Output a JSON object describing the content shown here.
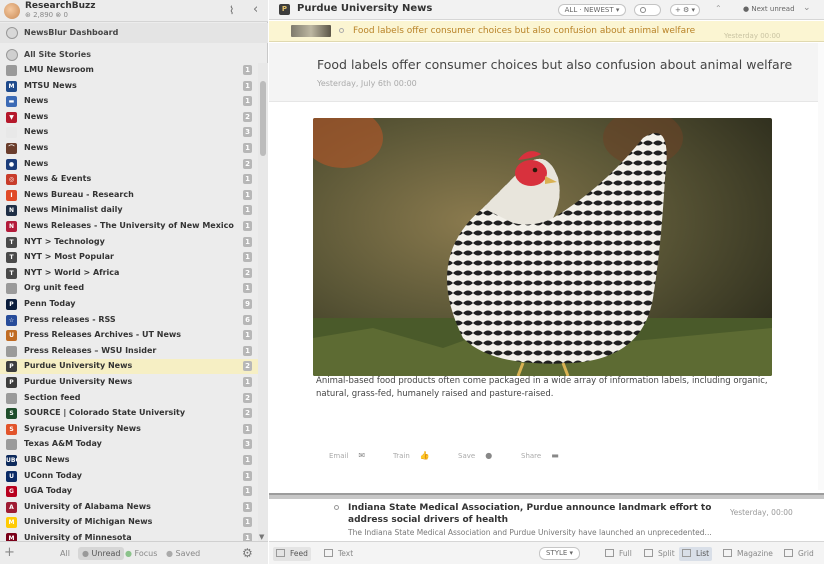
{
  "sidebar": {
    "username": "ResearchBuzz",
    "stats": "⊛ 2,890  ⊗ 0",
    "dashboard_label": "NewsBlur Dashboard",
    "all_stories_label": "All Site Stories",
    "feeds": [
      {
        "name": "LMU Newsroom",
        "count": "1",
        "icon_color": "#9a9a9a",
        "icon_text": ""
      },
      {
        "name": "MTSU News",
        "count": "1",
        "icon_color": "#1e4a8c",
        "icon_text": "M"
      },
      {
        "name": "News",
        "count": "1",
        "icon_color": "#3b6ab5",
        "icon_text": "▬"
      },
      {
        "name": "News",
        "count": "2",
        "icon_color": "#b5182b",
        "icon_text": "▼"
      },
      {
        "name": "News",
        "count": "3",
        "icon_color": "#e8e8e8",
        "icon_text": ""
      },
      {
        "name": "News",
        "count": "1",
        "icon_color": "#6a3d2c",
        "icon_text": "⌒"
      },
      {
        "name": "News",
        "count": "2",
        "icon_color": "#1b3c7a",
        "icon_text": "●"
      },
      {
        "name": "News & Events",
        "count": "1",
        "icon_color": "#c83c2a",
        "icon_text": "◎"
      },
      {
        "name": "News Bureau - Research",
        "count": "1",
        "icon_color": "#e04a27",
        "icon_text": "I"
      },
      {
        "name": "News Minimalist daily",
        "count": "1",
        "icon_color": "#1f2f46",
        "icon_text": "N"
      },
      {
        "name": "News Releases - The University of New Mexico",
        "count": "1",
        "icon_color": "#b31b3a",
        "icon_text": "N"
      },
      {
        "name": "NYT > Technology",
        "count": "1",
        "icon_color": "#4a4a4a",
        "icon_text": "T"
      },
      {
        "name": "NYT > Most Popular",
        "count": "1",
        "icon_color": "#4a4a4a",
        "icon_text": "T"
      },
      {
        "name": "NYT > World > Africa",
        "count": "2",
        "icon_color": "#4a4a4a",
        "icon_text": "T"
      },
      {
        "name": "Org unit feed",
        "count": "1",
        "icon_color": "#9a9a9a",
        "icon_text": ""
      },
      {
        "name": "Penn Today",
        "count": "9",
        "icon_color": "#0a1c3c",
        "icon_text": "P"
      },
      {
        "name": "Press releases - RSS",
        "count": "6",
        "icon_color": "#274c9a",
        "icon_text": "☆"
      },
      {
        "name": "Press Releases Archives - UT News",
        "count": "1",
        "icon_color": "#c06b23",
        "icon_text": "U"
      },
      {
        "name": "Press Releases – WSU Insider",
        "count": "1",
        "icon_color": "#9a9a9a",
        "icon_text": ""
      },
      {
        "name": "Purdue University News",
        "count": "2",
        "icon_color": "#3d3d3d",
        "icon_text": "P",
        "selected": true
      },
      {
        "name": "Purdue University News",
        "count": "1",
        "icon_color": "#3d3d3d",
        "icon_text": "P"
      },
      {
        "name": "Section feed",
        "count": "2",
        "icon_color": "#9a9a9a",
        "icon_text": ""
      },
      {
        "name": "SOURCE | Colorado State University",
        "count": "2",
        "icon_color": "#1e4d2b",
        "icon_text": "S"
      },
      {
        "name": "Syracuse University News",
        "count": "1",
        "icon_color": "#e2542b",
        "icon_text": "S"
      },
      {
        "name": "Texas A&M Today",
        "count": "3",
        "icon_color": "#9a9a9a",
        "icon_text": ""
      },
      {
        "name": "UBC News",
        "count": "1",
        "icon_color": "#0d2a5c",
        "icon_text": "UBC"
      },
      {
        "name": "UConn Today",
        "count": "1",
        "icon_color": "#0a2a66",
        "icon_text": "U"
      },
      {
        "name": "UGA Today",
        "count": "1",
        "icon_color": "#b8001e",
        "icon_text": "G"
      },
      {
        "name": "University of Alabama News",
        "count": "1",
        "icon_color": "#9e1b32",
        "icon_text": "A"
      },
      {
        "name": "University of Michigan News",
        "count": "1",
        "icon_color": "#ffcb05",
        "icon_text": "M"
      },
      {
        "name": "University of Minnesota",
        "count": "1",
        "icon_color": "#7a0019",
        "icon_text": "M"
      }
    ],
    "footer_tabs": {
      "all": "All",
      "unread": "Unread",
      "focus": "Focus",
      "saved": "Saved"
    }
  },
  "topbar": {
    "feed_title": "Purdue University News",
    "order_select": "ALL · NEWEST ▾",
    "options_label": "+ ⚙ ▾",
    "next_unread": "Next unread"
  },
  "story_strip": {
    "title": "Food labels offer consumer choices but also confusion about animal welfare",
    "date": "Yesterday 00:00"
  },
  "story": {
    "title": "Food labels offer consumer choices but also confusion about animal welfare",
    "date": "Yesterday, July 6th 00:00",
    "caption": "Animal-based food products often come packaged in a wide array of information labels, including organic, natural, grass-fed, humanely raised and pasture-raised.",
    "actions": {
      "email": "Email",
      "train": "Train",
      "save": "Save",
      "share": "Share"
    }
  },
  "next_story": {
    "title": "Indiana State Medical Association, Purdue announce landmark effort to address social drivers of health",
    "snippet": "The Indiana State Medical Association and Purdue University have launched an unprecedented...",
    "date": "Yesterday, 00:00"
  },
  "bottombar": {
    "feed": "Feed",
    "text": "Text",
    "style": "STYLE ▾",
    "full": "Full",
    "split": "Split",
    "list": "List",
    "magazine": "Magazine",
    "grid": "Grid"
  }
}
